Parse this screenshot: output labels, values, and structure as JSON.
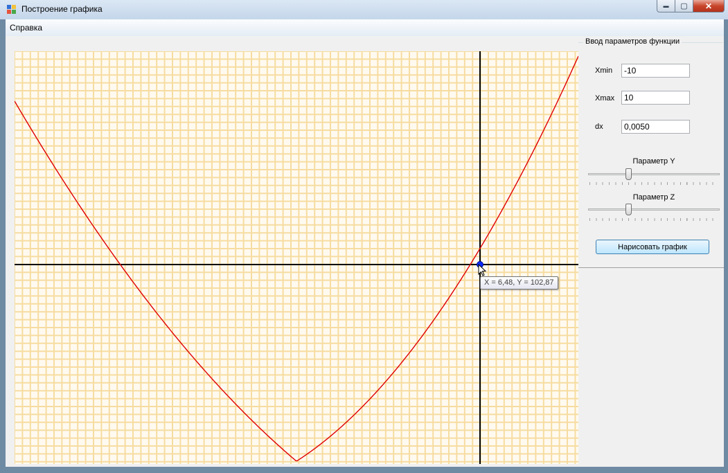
{
  "window": {
    "title": "Построение графика",
    "controls": {
      "minimize": "▬",
      "maximize": "▢",
      "close": "✕"
    }
  },
  "menu": {
    "items": [
      "Справка"
    ]
  },
  "panel": {
    "group_title": "Ввод параметров функции",
    "xmin": {
      "label": "Xmin",
      "value": "-10"
    },
    "xmax": {
      "label": "Xmax",
      "value": "10"
    },
    "dx": {
      "label": "dx",
      "value": "0,0050"
    },
    "param_y": {
      "label": "Параметр Y",
      "position": 0.3
    },
    "param_z": {
      "label": "Параметр Z",
      "position": 0.3
    },
    "draw_button": "Нарисовать график"
  },
  "plot": {
    "tooltip": "X = 6,48, Y = 102,87",
    "colors": {
      "curve": "#e00000",
      "axes": "#000000",
      "grid": "#f6dca0",
      "background": "#fffaf0",
      "marker": "#0a2aff"
    }
  }
}
